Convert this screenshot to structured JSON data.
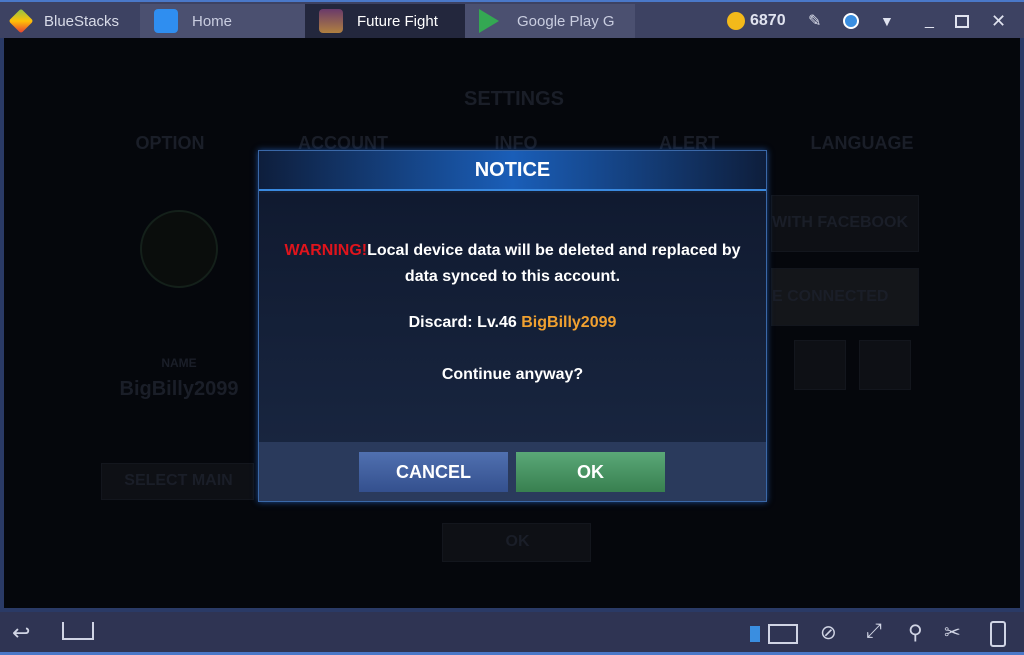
{
  "titlebar": {
    "app_name": "BlueStacks",
    "tabs": [
      {
        "label": "Home"
      },
      {
        "label": "Future Fight"
      },
      {
        "label": "Google Play G"
      }
    ],
    "coins": "6870"
  },
  "settings": {
    "title": "SETTINGS",
    "tabs": [
      "OPTION",
      "ACCOUNT",
      "INFO",
      "ALERT",
      "LANGUAGE"
    ],
    "name_label": "NAME",
    "name_value": "BigBilly2099",
    "select_main": "SELECT MAIN",
    "facebook_fragment": "WITH FACEBOOK",
    "connected_fragment": "E CONNECTED",
    "ok": "OK"
  },
  "dialog": {
    "title": "NOTICE",
    "warning": "WARNING!",
    "message": "Local device data will be deleted and replaced by data synced to this account.",
    "discard_prefix": "Discard: Lv.46 ",
    "discard_name": "BigBilly2099",
    "question": "Continue anyway?",
    "cancel": "CANCEL",
    "ok": "OK"
  },
  "colors": {
    "warning": "#e0141c",
    "name": "#f0a030",
    "cancel": "#3e5fa0",
    "ok": "#3f8f5e"
  }
}
